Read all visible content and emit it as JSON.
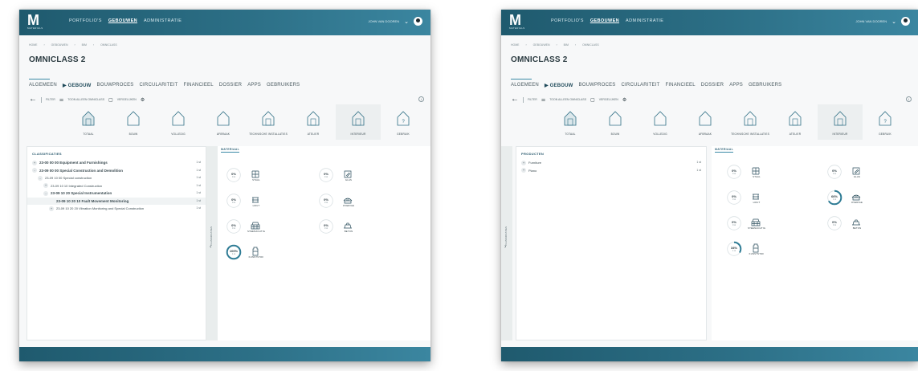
{
  "screens": [
    {
      "nav": {
        "logo": "M",
        "logo_sub": "MATERIALS",
        "items": [
          "PORTFOLIO'S",
          "GEBOUWEN",
          "ADMINISTRATIE"
        ],
        "active_index": 1,
        "user": "JOHN VAN DOOREN"
      },
      "breadcrumb": [
        "HOME",
        "GEBOUWEN",
        "BIM",
        "OMNICLASS"
      ],
      "page_title": "OMNICLASS 2",
      "tabs": [
        "ALGEMEEN",
        "▶ GEBOUW",
        "BOUWPROCES",
        "CIRCULARITEIT",
        "FINANCIEEL",
        "DOSSIER",
        "APPS",
        "GEBRUIKERS"
      ],
      "active_tab": 1,
      "toolbar": [
        "FILTER",
        "TOON ALLEEN OMNICLASS",
        "VERGELIJKEN"
      ],
      "phases": [
        "TOTAAL",
        "BOUW",
        "VOLLEDIG",
        "AFBRAAK",
        "TECHNISCHE INSTALLATIES",
        "ATELIER",
        "INTERIEUR",
        "GEBRUIK"
      ],
      "selected_phase": 6,
      "panel_header": "CLASSIFICATIES",
      "tree": [
        {
          "label": "23-00 00 00 Equipment and Furnishings",
          "value": "1 st",
          "level": 0,
          "expander": "+",
          "bold": true
        },
        {
          "label": "23-09 00 00 Special Construction and Demolition",
          "value": "1 st",
          "level": 0,
          "expander": "-",
          "bold": true
        },
        {
          "label": "23-09 10 00 Special construction",
          "value": "1 st",
          "level": 1,
          "expander": "-",
          "bold": false
        },
        {
          "label": "23-09 10 10 Integrated Construction",
          "value": "1 st",
          "level": 2,
          "expander": "+",
          "bold": false
        },
        {
          "label": "23-09 10 20 Special Instrumentation",
          "value": "1 st",
          "level": 2,
          "expander": "-",
          "bold": true
        },
        {
          "label": "23-09 10 20 10 Fault Movement Monitoring",
          "value": "1 st",
          "level": 3,
          "expander": "",
          "bold": true
        },
        {
          "label": "23-09 10 20 20 Vibration Monitoring and Special Construction",
          "value": "1 st",
          "level": 3,
          "expander": "+",
          "bold": false
        }
      ],
      "collapse_label": "CLASSIFICATIES",
      "right_tab": "MATERIAAL",
      "materials": [
        {
          "pct": "0%",
          "small": "0 st",
          "label": "STAAL",
          "icon": "steel-icon"
        },
        {
          "pct": "0%",
          "small": "0 st",
          "label": "HOUT",
          "icon": "wood-icon"
        },
        {
          "pct": "0%",
          "small": "0 st",
          "label": "STEENACHTIG",
          "icon": "stone-icon"
        },
        {
          "pct": "100%",
          "small": "1 st",
          "label": "KUNSTSTOF",
          "icon": "plastic-icon",
          "fraction": 1.0
        },
        {
          "pct": "0%",
          "small": "0 st",
          "label": "GLAS",
          "icon": "glass-icon"
        },
        {
          "pct": "0%",
          "small": "0 st",
          "label": "OVERIGE",
          "icon": "other-icon"
        },
        {
          "pct": "0%",
          "small": "0 st",
          "label": "BETON",
          "icon": "concrete-icon"
        }
      ]
    },
    {
      "nav": {
        "logo": "M",
        "logo_sub": "MATERIALS",
        "items": [
          "PORTFOLIO'S",
          "GEBOUWEN",
          "ADMINISTRATIE"
        ],
        "active_index": 1,
        "user": "JOHN VAN DOOREN"
      },
      "breadcrumb": [
        "HOME",
        "GEBOUWEN",
        "BIM",
        "OMNICLASS"
      ],
      "page_title": "OMNICLASS 2",
      "tabs": [
        "ALGEMEEN",
        "▶ GEBOUW",
        "BOUWPROCES",
        "CIRCULARITEIT",
        "FINANCIEEL",
        "DOSSIER",
        "APPS",
        "GEBRUIKERS"
      ],
      "active_tab": 1,
      "toolbar": [
        "FILTER",
        "TOON ALLEEN OMNICLASS",
        "VERGELIJKEN"
      ],
      "phases": [
        "TOTAAL",
        "BOUW",
        "VOLLEDIG",
        "AFBRAAK",
        "TECHNISCHE INSTALLATIES",
        "ATELIER",
        "INTERIEUR",
        "GEBRUIK"
      ],
      "selected_phase": 6,
      "panel_header": "PRODUCTEN",
      "tree": [
        {
          "label": "Furniture",
          "value": "1 st",
          "level": 0,
          "expander": "+",
          "bold": false
        },
        {
          "label": "Piano",
          "value": "1 st",
          "level": 0,
          "expander": "+",
          "bold": false
        }
      ],
      "collapse_label": "CLASSIFICATIES",
      "right_tab": "MATERIAAL",
      "materials": [
        {
          "pct": "0%",
          "small": "0 st",
          "label": "STAAL",
          "icon": "steel-icon"
        },
        {
          "pct": "0%",
          "small": "0 st",
          "label": "HOUT",
          "icon": "wood-icon"
        },
        {
          "pct": "0%",
          "small": "0 st",
          "label": "STEENACHTIG",
          "icon": "stone-icon"
        },
        {
          "pct": "34%",
          "small": "1 st",
          "label": "KUNSTSTOF",
          "icon": "plastic-icon",
          "fraction": 0.34
        },
        {
          "pct": "0%",
          "small": "0 st",
          "label": "GLAS",
          "icon": "glass-icon"
        },
        {
          "pct": "66%",
          "small": "1 st",
          "label": "OVERIGE",
          "icon": "other-icon",
          "fraction": 0.66
        },
        {
          "pct": "0%",
          "small": "0 st",
          "label": "BETON",
          "icon": "concrete-icon"
        }
      ]
    }
  ],
  "colors": {
    "bar_dark": "#1f5a6e",
    "bar_light": "#3b86a0",
    "accent": "#2f7c95",
    "ring_track": "#d9e0e3"
  }
}
